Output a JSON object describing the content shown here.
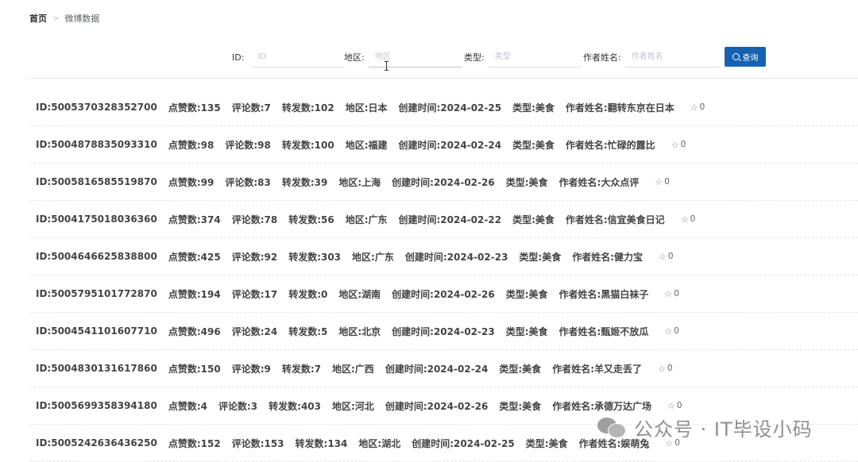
{
  "breadcrumb": {
    "home": "首页",
    "separator": ">",
    "current": "微博数据"
  },
  "search": {
    "id_label": "ID:",
    "id_placeholder": "ID",
    "region_label": "地区:",
    "region_placeholder": "地区",
    "type_label": "类型:",
    "type_placeholder": "类型",
    "author_label": "作者姓名:",
    "author_placeholder": "作者姓名",
    "button_label": "查询"
  },
  "rows": [
    {
      "id": "ID:5005370328352700",
      "likes": "点赞数:135",
      "comments": "评论数:7",
      "reposts": "转发数:102",
      "region": "地区:日本",
      "created": "创建时间:2024-02-25",
      "type": "类型:美食",
      "author": "作者姓名:翻转东京在日本",
      "fav": "0"
    },
    {
      "id": "ID:5004878835093310",
      "likes": "点赞数:98",
      "comments": "评论数:98",
      "reposts": "转发数:100",
      "region": "地区:福建",
      "created": "创建时间:2024-02-24",
      "type": "类型:美食",
      "author": "作者姓名:忙碌的露比",
      "fav": "0"
    },
    {
      "id": "ID:5005816585519870",
      "likes": "点赞数:99",
      "comments": "评论数:83",
      "reposts": "转发数:39",
      "region": "地区:上海",
      "created": "创建时间:2024-02-26",
      "type": "类型:美食",
      "author": "作者姓名:大众点评",
      "fav": "0"
    },
    {
      "id": "ID:5004175018036360",
      "likes": "点赞数:374",
      "comments": "评论数:78",
      "reposts": "转发数:56",
      "region": "地区:广东",
      "created": "创建时间:2024-02-22",
      "type": "类型:美食",
      "author": "作者姓名:信宜美食日记",
      "fav": "0"
    },
    {
      "id": "ID:5004646625838800",
      "likes": "点赞数:425",
      "comments": "评论数:92",
      "reposts": "转发数:303",
      "region": "地区:广东",
      "created": "创建时间:2024-02-23",
      "type": "类型:美食",
      "author": "作者姓名:健力宝",
      "fav": "0"
    },
    {
      "id": "ID:5005795101772870",
      "likes": "点赞数:194",
      "comments": "评论数:17",
      "reposts": "转发数:0",
      "region": "地区:湖南",
      "created": "创建时间:2024-02-26",
      "type": "类型:美食",
      "author": "作者姓名:黑猫白袜子",
      "fav": "0"
    },
    {
      "id": "ID:5004541101607710",
      "likes": "点赞数:496",
      "comments": "评论数:24",
      "reposts": "转发数:5",
      "region": "地区:北京",
      "created": "创建时间:2024-02-23",
      "type": "类型:美食",
      "author": "作者姓名:甄姬不放瓜",
      "fav": "0"
    },
    {
      "id": "ID:5004830131617860",
      "likes": "点赞数:150",
      "comments": "评论数:9",
      "reposts": "转发数:7",
      "region": "地区:广西",
      "created": "创建时间:2024-02-24",
      "type": "类型:美食",
      "author": "作者姓名:羊又走丢了",
      "fav": "0"
    },
    {
      "id": "ID:5005699358394180",
      "likes": "点赞数:4",
      "comments": "评论数:3",
      "reposts": "转发数:403",
      "region": "地区:河北",
      "created": "创建时间:2024-02-26",
      "type": "类型:美食",
      "author": "作者姓名:承德万达广场",
      "fav": "0"
    },
    {
      "id": "ID:5005242636436250",
      "likes": "点赞数:152",
      "comments": "评论数:153",
      "reposts": "转发数:134",
      "region": "地区:湖北",
      "created": "创建时间:2024-02-25",
      "type": "类型:美食",
      "author": "作者姓名:娱萌兔",
      "fav": "0"
    }
  ],
  "watermark": {
    "text": "公众号 · IT毕设小码"
  },
  "colors": {
    "primary_button": "#1662b1",
    "text": "#303133",
    "divider": "#e4e7ed"
  }
}
